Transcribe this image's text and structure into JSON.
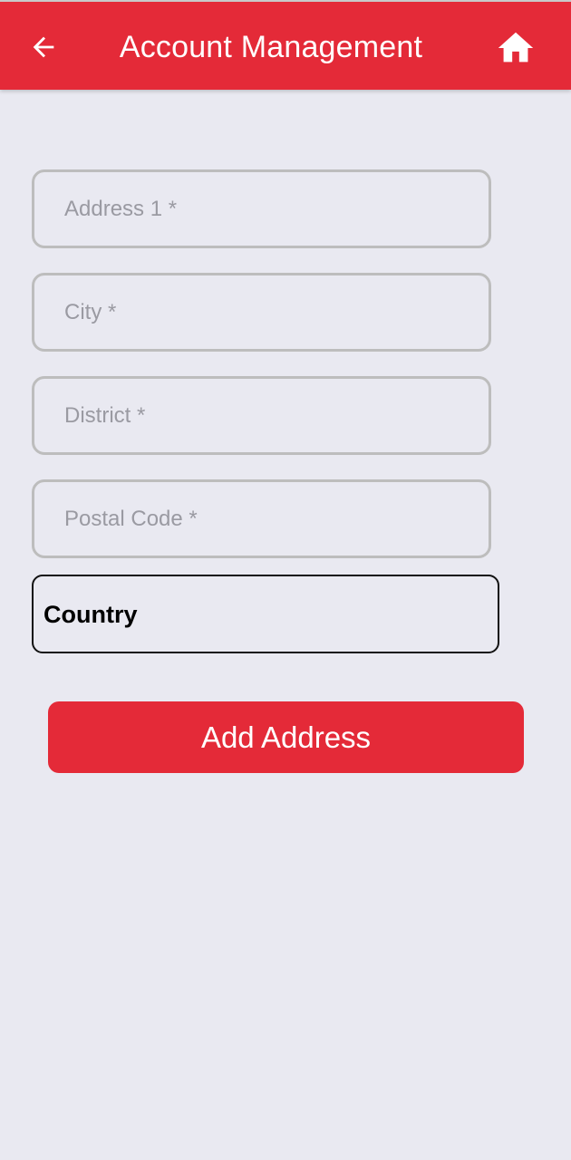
{
  "header": {
    "title": "Account Management",
    "back_icon": "arrow-left-icon",
    "home_icon": "home-icon",
    "background_color": "#E42A38"
  },
  "form": {
    "address1": {
      "placeholder": "Address 1 *",
      "value": ""
    },
    "city": {
      "placeholder": "City *",
      "value": ""
    },
    "district": {
      "placeholder": "District *",
      "value": ""
    },
    "postal_code": {
      "placeholder": "Postal Code *",
      "value": ""
    },
    "country": {
      "label": "Country"
    },
    "submit_label": "Add Address"
  },
  "colors": {
    "accent": "#E42A38",
    "background": "#E9E9F1",
    "field_border": "#BDBDBD",
    "placeholder": "#9A9AA2"
  }
}
